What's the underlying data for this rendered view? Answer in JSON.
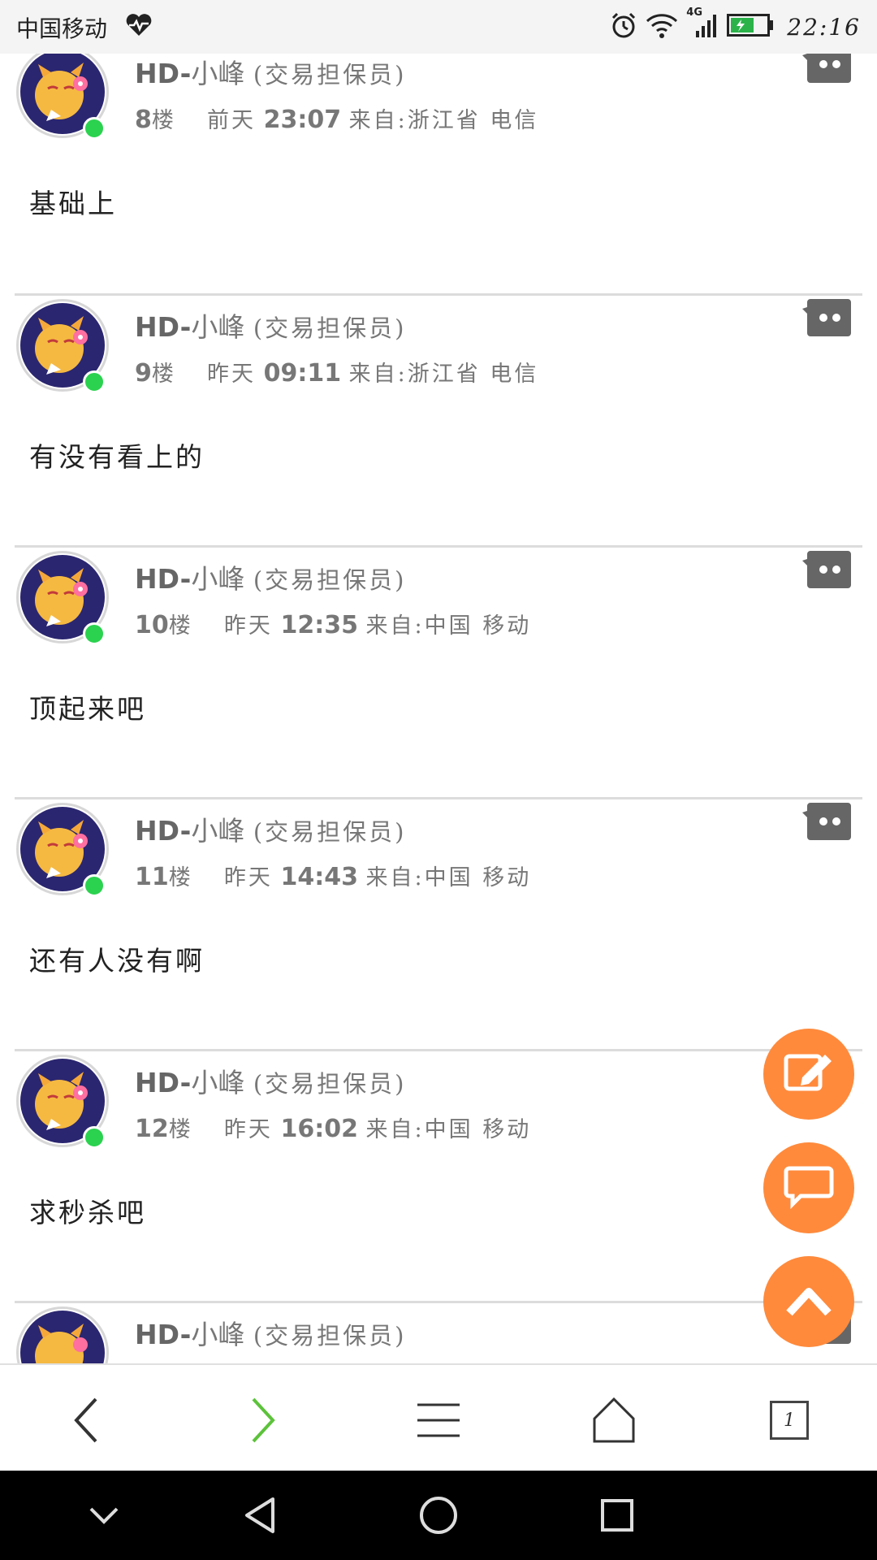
{
  "status_bar": {
    "carrier": "中国移动",
    "time": "22:16",
    "network": "4G",
    "icons": [
      "heart-pulse-icon",
      "alarm-icon",
      "wifi-icon",
      "signal-icon",
      "battery-charging-icon"
    ]
  },
  "posts": [
    {
      "author_en": "HD-",
      "author_cn": "小峰",
      "role": "(交易担保员)",
      "floor_num": "8",
      "floor_unit": "楼",
      "day": "前天",
      "time": "23:07",
      "from_label": "来自:",
      "location": "浙江省 电信",
      "content": "基础上"
    },
    {
      "author_en": "HD-",
      "author_cn": "小峰",
      "role": "(交易担保员)",
      "floor_num": "9",
      "floor_unit": "楼",
      "day": "昨天",
      "time": "09:11",
      "from_label": "来自:",
      "location": "浙江省 电信",
      "content": "有没有看上的"
    },
    {
      "author_en": "HD-",
      "author_cn": "小峰",
      "role": "(交易担保员)",
      "floor_num": "10",
      "floor_unit": "楼",
      "day": "昨天",
      "time": "12:35",
      "from_label": "来自:",
      "location": "中国 移动",
      "content": "顶起来吧"
    },
    {
      "author_en": "HD-",
      "author_cn": "小峰",
      "role": "(交易担保员)",
      "floor_num": "11",
      "floor_unit": "楼",
      "day": "昨天",
      "time": "14:43",
      "from_label": "来自:",
      "location": "中国 移动",
      "content": "还有人没有啊"
    },
    {
      "author_en": "HD-",
      "author_cn": "小峰",
      "role": "(交易担保员)",
      "floor_num": "12",
      "floor_unit": "楼",
      "day": "昨天",
      "time": "16:02",
      "from_label": "来自:",
      "location": "中国 移动",
      "content": "求秒杀吧"
    },
    {
      "author_en": "HD-",
      "author_cn": "小峰",
      "role": "(交易担保员)",
      "floor_num": "",
      "floor_unit": "",
      "day": "",
      "time": "",
      "from_label": "",
      "location": "",
      "content": ""
    }
  ],
  "floating_buttons": [
    "edit-icon",
    "comment-icon",
    "scroll-top-icon"
  ],
  "browser_nav": {
    "items": [
      "back-icon",
      "forward-icon",
      "menu-icon",
      "home-icon",
      "tabs-icon"
    ],
    "tab_count": "1"
  },
  "system_nav": {
    "items": [
      "collapse-icon",
      "back-triangle-icon",
      "home-circle-icon",
      "recents-square-icon"
    ]
  },
  "colors": {
    "accent": "#ff8a3c",
    "online": "#2bd24f",
    "forward_active": "#5cc23a"
  }
}
